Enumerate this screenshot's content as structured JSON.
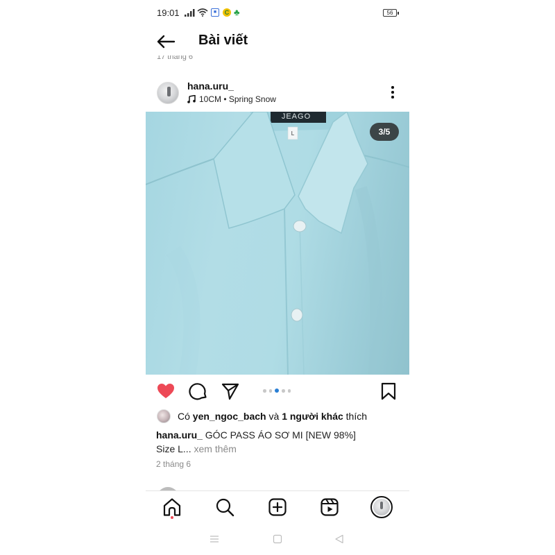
{
  "status_bar": {
    "time": "19:01",
    "battery": "56",
    "icons": [
      "signal-icon",
      "wifi-icon",
      "notification-app-icon",
      "coin-app-icon",
      "game-app-icon",
      "battery-icon"
    ]
  },
  "header": {
    "title": "Bài viết",
    "back_icon": "arrow-left-icon"
  },
  "previous_post_date": "17 tháng 6",
  "post": {
    "username": "hana.uru_",
    "music_icon": "music-note-icon",
    "music": "10CM • Spring Snow",
    "image_counter": "3/5",
    "carousel": {
      "count": 5,
      "active_index": 2
    },
    "actions": [
      "heart-filled-icon",
      "comment-icon",
      "share-icon",
      "bookmark-icon"
    ],
    "liked": true,
    "likes": {
      "prefix": "Có",
      "user": "yen_ngoc_bach",
      "conj": "và",
      "others": "1 người khác",
      "suffix": "thích"
    },
    "caption": {
      "username": "hana.uru_",
      "text_line1": "GÓC PASS ÁO SƠ MI [NEW 98%]",
      "text_line2": "Size L...",
      "more": "xem thêm"
    },
    "date": "2 tháng 6"
  },
  "bottom_nav": {
    "items": [
      "home-icon",
      "search-icon",
      "new-post-icon",
      "reels-icon",
      "profile-avatar"
    ],
    "active": "home-icon"
  },
  "system_nav": [
    "menu-icon",
    "home-square-icon",
    "back-triangle-icon"
  ],
  "colors": {
    "like": "#ed4956",
    "carousel_active": "#2a7fd4",
    "muted_text": "#8a8a8a"
  }
}
